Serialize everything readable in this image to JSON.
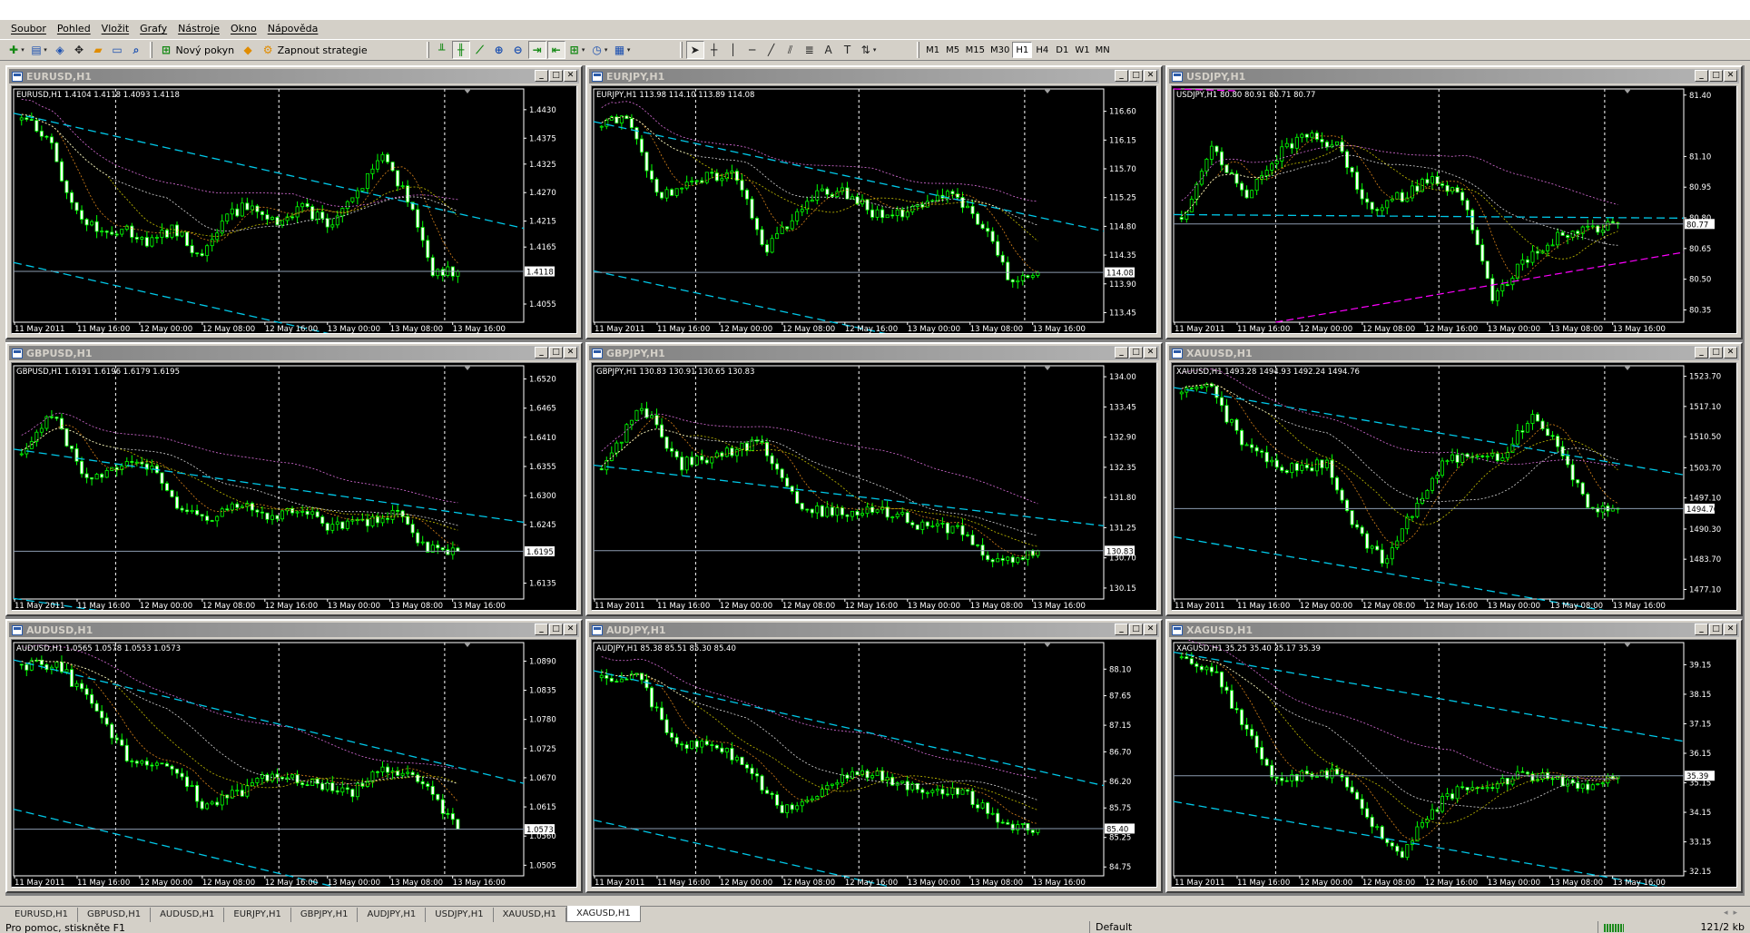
{
  "menu": [
    "Soubor",
    "Pohled",
    "Vložit",
    "Grafy",
    "Nástroje",
    "Okno",
    "Nápověda"
  ],
  "toolbar": {
    "new_order_label": "Nový pokyn",
    "strategy_label": "Zapnout strategie",
    "timeframes": [
      "M1",
      "M5",
      "M15",
      "M30",
      "H1",
      "H4",
      "D1",
      "W1",
      "MN"
    ],
    "active_timeframe": "H1"
  },
  "time_labels": [
    "11 May 2011",
    "11 May 16:00",
    "12 May 00:00",
    "12 May 08:00",
    "12 May 16:00",
    "13 May 00:00",
    "13 May 08:00",
    "13 May 16:00"
  ],
  "colors": {
    "bull": "#00ff00",
    "bear": "#ffffff",
    "channel": "#00c8e8",
    "ma_fast": "#ff9a1f",
    "ma_mid": "#e8e000",
    "ma_slow": "#ffffff",
    "ma_long": "#ff80ff",
    "support": "#ff00ff",
    "bid_line": "#8c9bb0"
  },
  "charts": [
    {
      "title": "EURUSD,H1",
      "info": "EURUSD,H1  1.4104 1.4118 1.4093 1.4118",
      "ylim": [
        1.402,
        1.447
      ],
      "yticks": [
        "1.4430",
        "1.4375",
        "1.4325",
        "1.4270",
        "1.4215",
        "1.4165",
        "1.4055"
      ],
      "current": "1.4118",
      "path": [
        1.442,
        1.438,
        1.424,
        1.419,
        1.42,
        1.4175,
        1.42,
        1.414,
        1.4225,
        1.425,
        1.421,
        1.424,
        1.421,
        1.426,
        1.434,
        1.426,
        1.412,
        1.4118
      ]
    },
    {
      "title": "EURJPY,H1",
      "info": "EURJPY,H1  113.98 114.10 113.89 114.08",
      "ylim": [
        113.3,
        116.95
      ],
      "yticks": [
        "116.60",
        "116.15",
        "115.70",
        "115.25",
        "114.80",
        "114.35",
        "113.90",
        "113.45"
      ],
      "current": "114.08",
      "path": [
        116.4,
        116.5,
        115.3,
        115.4,
        115.6,
        115.6,
        114.4,
        114.9,
        115.4,
        115.3,
        115.0,
        115.0,
        115.2,
        115.3,
        114.8,
        113.95,
        114.08
      ]
    },
    {
      "title": "USDJPY,H1",
      "info": "USDJPY,H1  80.80 80.91 80.71 80.77",
      "ylim": [
        80.29,
        81.43
      ],
      "yticks": [
        "81.40",
        "81.10",
        "80.95",
        "80.80",
        "80.65",
        "80.50",
        "80.35"
      ],
      "current": "80.77",
      "path": [
        80.8,
        81.15,
        80.9,
        81.1,
        81.2,
        81.15,
        80.85,
        80.9,
        81.0,
        80.9,
        80.4,
        80.6,
        80.7,
        80.75,
        80.77
      ]
    },
    {
      "title": "GBPUSD,H1",
      "info": "GBPUSD,H1  1.6191 1.6196 1.6179 1.6195",
      "ylim": [
        1.6105,
        1.6545
      ],
      "yticks": [
        "1.6520",
        "1.6465",
        "1.6410",
        "1.6355",
        "1.6300",
        "1.6245",
        "1.6135"
      ],
      "current": "1.6195",
      "path": [
        1.638,
        1.646,
        1.633,
        1.635,
        1.636,
        1.628,
        1.626,
        1.628,
        1.626,
        1.627,
        1.624,
        1.625,
        1.627,
        1.62,
        1.619
      ]
    },
    {
      "title": "GBPJPY,H1",
      "info": "GBPJPY,H1  130.83 130.91 130.65 130.83",
      "ylim": [
        129.95,
        134.2
      ],
      "yticks": [
        "134.00",
        "133.45",
        "132.90",
        "132.35",
        "131.80",
        "131.25",
        "130.70",
        "130.15"
      ],
      "current": "130.83",
      "path": [
        132.3,
        133.5,
        132.4,
        132.6,
        132.8,
        131.6,
        131.5,
        131.6,
        131.3,
        131.2,
        130.6,
        130.83
      ]
    },
    {
      "title": "XAUUSD,H1",
      "info": "XAUUSD,H1  1493.28 1494.93 1492.24 1494.76",
      "ylim": [
        1475.0,
        1526.0
      ],
      "yticks": [
        "1523.70",
        "1517.10",
        "1510.50",
        "1503.70",
        "1497.10",
        "1490.30",
        "1483.70",
        "1477.10"
      ],
      "current": "1494.76",
      "path": [
        1520,
        1521,
        1510,
        1505,
        1503,
        1505,
        1490,
        1483,
        1495,
        1505,
        1506,
        1506,
        1515,
        1508,
        1495,
        1494.76
      ]
    },
    {
      "title": "AUDUSD,H1",
      "info": "AUDUSD,H1  1.0565 1.0578 1.0553 1.0573",
      "ylim": [
        1.0485,
        1.0925
      ],
      "yticks": [
        "1.0890",
        "1.0835",
        "1.0780",
        "1.0725",
        "1.0670",
        "1.0615",
        "1.0560",
        "1.0505"
      ],
      "current": "1.0573",
      "path": [
        1.088,
        1.0885,
        1.08,
        1.07,
        1.07,
        1.062,
        1.064,
        1.068,
        1.066,
        1.064,
        1.069,
        1.066,
        1.0573
      ]
    },
    {
      "title": "AUDJPY,H1",
      "info": "AUDJPY,H1  85.38 85.51 85.30 85.40",
      "ylim": [
        84.6,
        88.55
      ],
      "yticks": [
        "88.10",
        "87.65",
        "87.15",
        "86.70",
        "86.20",
        "85.75",
        "85.25",
        "84.75"
      ],
      "current": "85.40",
      "path": [
        87.95,
        88.0,
        86.8,
        86.9,
        86.4,
        85.7,
        86.0,
        86.4,
        86.2,
        86.0,
        86.0,
        85.5,
        85.4
      ]
    },
    {
      "title": "XAGUSD,H1",
      "info": "XAGUSD,H1  35.25 35.40 35.17 35.39",
      "ylim": [
        32.0,
        39.9
      ],
      "yticks": [
        "39.15",
        "38.15",
        "37.15",
        "36.15",
        "35.15",
        "34.15",
        "33.15",
        "32.15"
      ],
      "current": "35.39",
      "path": [
        39.3,
        39.1,
        37.0,
        35.3,
        35.4,
        35.5,
        34.0,
        32.6,
        34.2,
        35.0,
        35.0,
        35.5,
        35.2,
        35.1,
        35.39
      ]
    }
  ],
  "tabs": [
    "EURUSD,H1",
    "GBPUSD,H1",
    "AUDUSD,H1",
    "EURJPY,H1",
    "GBPJPY,H1",
    "AUDJPY,H1",
    "USDJPY,H1",
    "XAUUSD,H1",
    "XAGUSD,H1"
  ],
  "active_tab": "XAGUSD,H1",
  "status": {
    "help": "Pro pomoc, stiskněte F1",
    "profile": "Default",
    "traffic": "121/2 kb"
  }
}
